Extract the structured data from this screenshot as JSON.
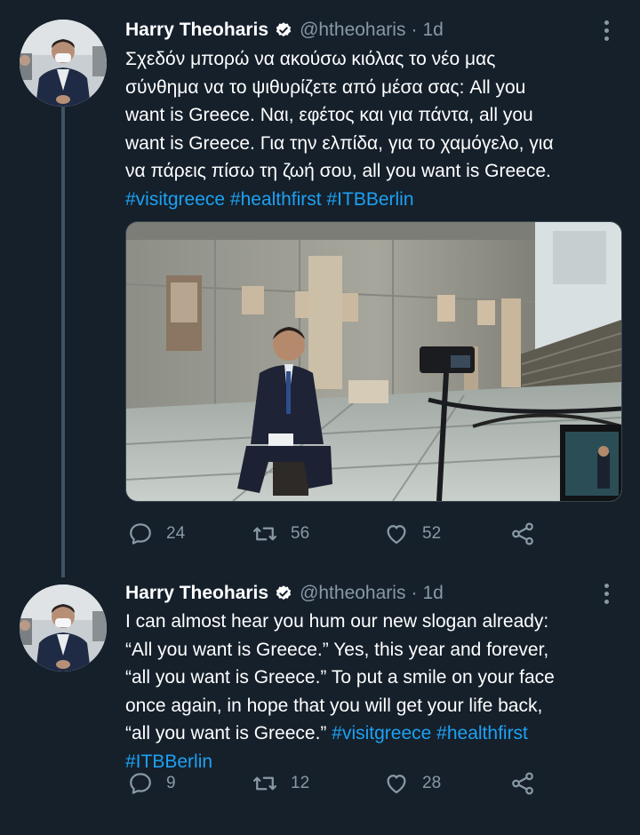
{
  "tweets": [
    {
      "author_name": "Harry Theoharis",
      "verified": true,
      "handle": "@htheoharis",
      "separator": "·",
      "age": "1d",
      "lines": [
        [
          {
            "text": "Σχεδόν μπορώ να ακούσω κιόλας το νέο μας"
          }
        ],
        [
          {
            "text": "σύνθημα να το ψιθυρίζετε από μέσα σας: All you"
          }
        ],
        [
          {
            "text": "want is Greece. Ναι, εφέτος και για πάντα, all you"
          }
        ],
        [
          {
            "text": "want is Greece. Για την ελπίδα, για το χαμόγελο, για"
          }
        ],
        [
          {
            "text": "να πάρεις πίσω τη ζωή σου, all you want is Greece."
          }
        ],
        [
          {
            "text": "#visitgreece",
            "hashtag": true
          },
          {
            "text": " "
          },
          {
            "text": "#healthfirst",
            "hashtag": true
          },
          {
            "text": " "
          },
          {
            "text": "#ITBBerlin",
            "hashtag": true
          }
        ]
      ],
      "has_media": true,
      "replies": "24",
      "retweets": "56",
      "likes": "52"
    },
    {
      "author_name": "Harry Theoharis",
      "verified": true,
      "handle": "@htheoharis",
      "separator": "·",
      "age": "1d",
      "lines": [
        [
          {
            "text": "I can almost hear you hum our new slogan already:"
          }
        ],
        [
          {
            "text": "“All you want is Greece.” Yes, this year and forever,"
          }
        ],
        [
          {
            "text": "“all you want is Greece.” To put a smile on your face"
          }
        ],
        [
          {
            "text": "once again, in hope that you will get your life back,"
          }
        ],
        [
          {
            "text": "“all you want is Greece.” "
          },
          {
            "text": "#visitgreece",
            "hashtag": true
          },
          {
            "text": " "
          },
          {
            "text": "#healthfirst",
            "hashtag": true
          }
        ],
        [
          {
            "text": "#ITBBerlin",
            "hashtag": true
          }
        ]
      ],
      "has_media": false,
      "replies": "9",
      "retweets": "12",
      "likes": "28"
    }
  ],
  "colors": {
    "background": "#15202b",
    "text": "#ffffff",
    "secondary": "#8899a6",
    "hashtag": "#1da1f2",
    "thread_line": "#3d5466"
  },
  "icons": {
    "reply": "reply-icon",
    "retweet": "retweet-icon",
    "like": "like-icon",
    "share": "share-icon",
    "verified": "verified-badge-icon",
    "more": "more-options-icon"
  }
}
